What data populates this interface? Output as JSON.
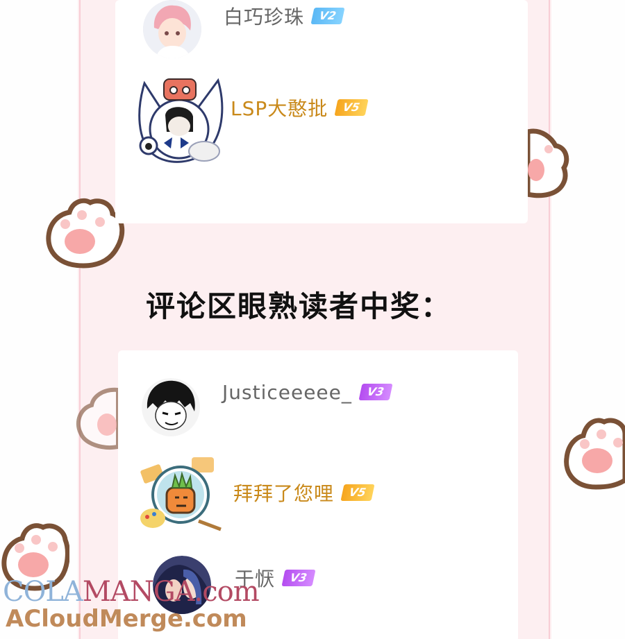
{
  "top_card": {
    "users": [
      {
        "name": "白巧珍珠",
        "level": "V2",
        "name_color": "gray",
        "avatar": "pink-hair-boy-avatar"
      },
      {
        "name": "LSP大憨批",
        "level": "V5",
        "name_color": "gold",
        "avatar": "cat-frame-avatar"
      }
    ]
  },
  "section_heading": "评论区眼熟读者中奖：",
  "bottom_card": {
    "users": [
      {
        "name": "Justiceeeee_",
        "level": "V3",
        "name_color": "gray",
        "avatar": "black-hair-boy-avatar"
      },
      {
        "name": "拜拜了您哩",
        "level": "V5",
        "name_color": "gold",
        "avatar": "carrot-frame-avatar"
      },
      {
        "name": "于恹",
        "level": "V3",
        "name_color": "gray",
        "avatar": "anime-couple-avatar"
      }
    ]
  },
  "watermark": {
    "line1_part1": "COLA",
    "line1_part2": "MANGA",
    "line1_part3": ".com",
    "line2": "ACloudMerge.com"
  },
  "colors": {
    "strip_bg": "#fdeff1",
    "name_gray": "#666666",
    "name_gold": "#c9891a",
    "badge_v2": "#5bb8f5",
    "badge_v3": "#b44df0",
    "badge_v5": "#f6a51e"
  }
}
